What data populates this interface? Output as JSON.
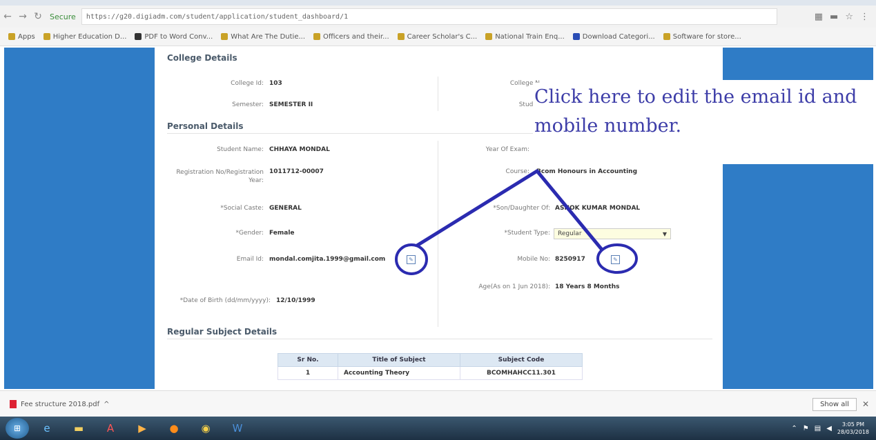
{
  "browser": {
    "secure_label": "Secure",
    "url": "https://g20.digiadm.com/student/application/student_dashboard/1",
    "bookmarks": [
      "Apps",
      "Higher Education D...",
      "PDF to Word Conv...",
      "What Are The Dutie...",
      "Officers and their...",
      "Career Scholar's C...",
      "National Train Enq...",
      "Download Categori...",
      "Software for store..."
    ]
  },
  "college": {
    "title": "College Details",
    "college_id_label": "College Id:",
    "college_id_value": "103",
    "college_n_label": "College N",
    "semester_label": "Semester:",
    "semester_value": "SEMESTER II",
    "stud_h_label": "Stud H"
  },
  "personal": {
    "title": "Personal Details",
    "student_name_label": "Student Name:",
    "student_name_value": "CHHAYA MONDAL",
    "year_of_exam_label": "Year Of Exam:",
    "reg_no_label": "Registration No/Registration Year:",
    "reg_no_value": "1011712-00007",
    "course_label": "Course:",
    "course_value": "Bcom Honours in Accounting",
    "social_caste_label": "*Social Caste:",
    "social_caste_value": "GENERAL",
    "son_daughter_label": "*Son/Daughter Of:",
    "son_daughter_value": "ASHOK KUMAR MONDAL",
    "gender_label": "*Gender:",
    "gender_value": "Female",
    "student_type_label": "*Student Type:",
    "student_type_value": "Regular",
    "email_label": "Email Id:",
    "email_value": "mondal.comjita.1999@gmail.com",
    "mobile_label": "Mobile No:",
    "mobile_value": "8250917",
    "dob_label": "*Date of Birth (dd/mm/yyyy):",
    "dob_value": "12/10/1999",
    "age_label": "Age(As on 1 Jun 2018):",
    "age_value": "18 Years 8 Months"
  },
  "subjects": {
    "title": "Regular Subject Details",
    "headers": [
      "Sr No.",
      "Title of Subject",
      "Subject Code"
    ],
    "rows": [
      [
        "1",
        "Accounting Theory",
        "BCOMHAHCC11.301"
      ]
    ]
  },
  "callout": {
    "line1": "Click here to edit the email id and",
    "line2": "mobile number."
  },
  "download_bar": {
    "file_name": "Fee structure 2018.pdf",
    "show_all": "Show all"
  },
  "taskbar": {
    "time": "3:05 PM",
    "date": "28/03/2018"
  },
  "colors": {
    "side_panel": "#2f7cc6",
    "annotation": "#2b2bb0",
    "callout_text": "#3d3da8"
  }
}
